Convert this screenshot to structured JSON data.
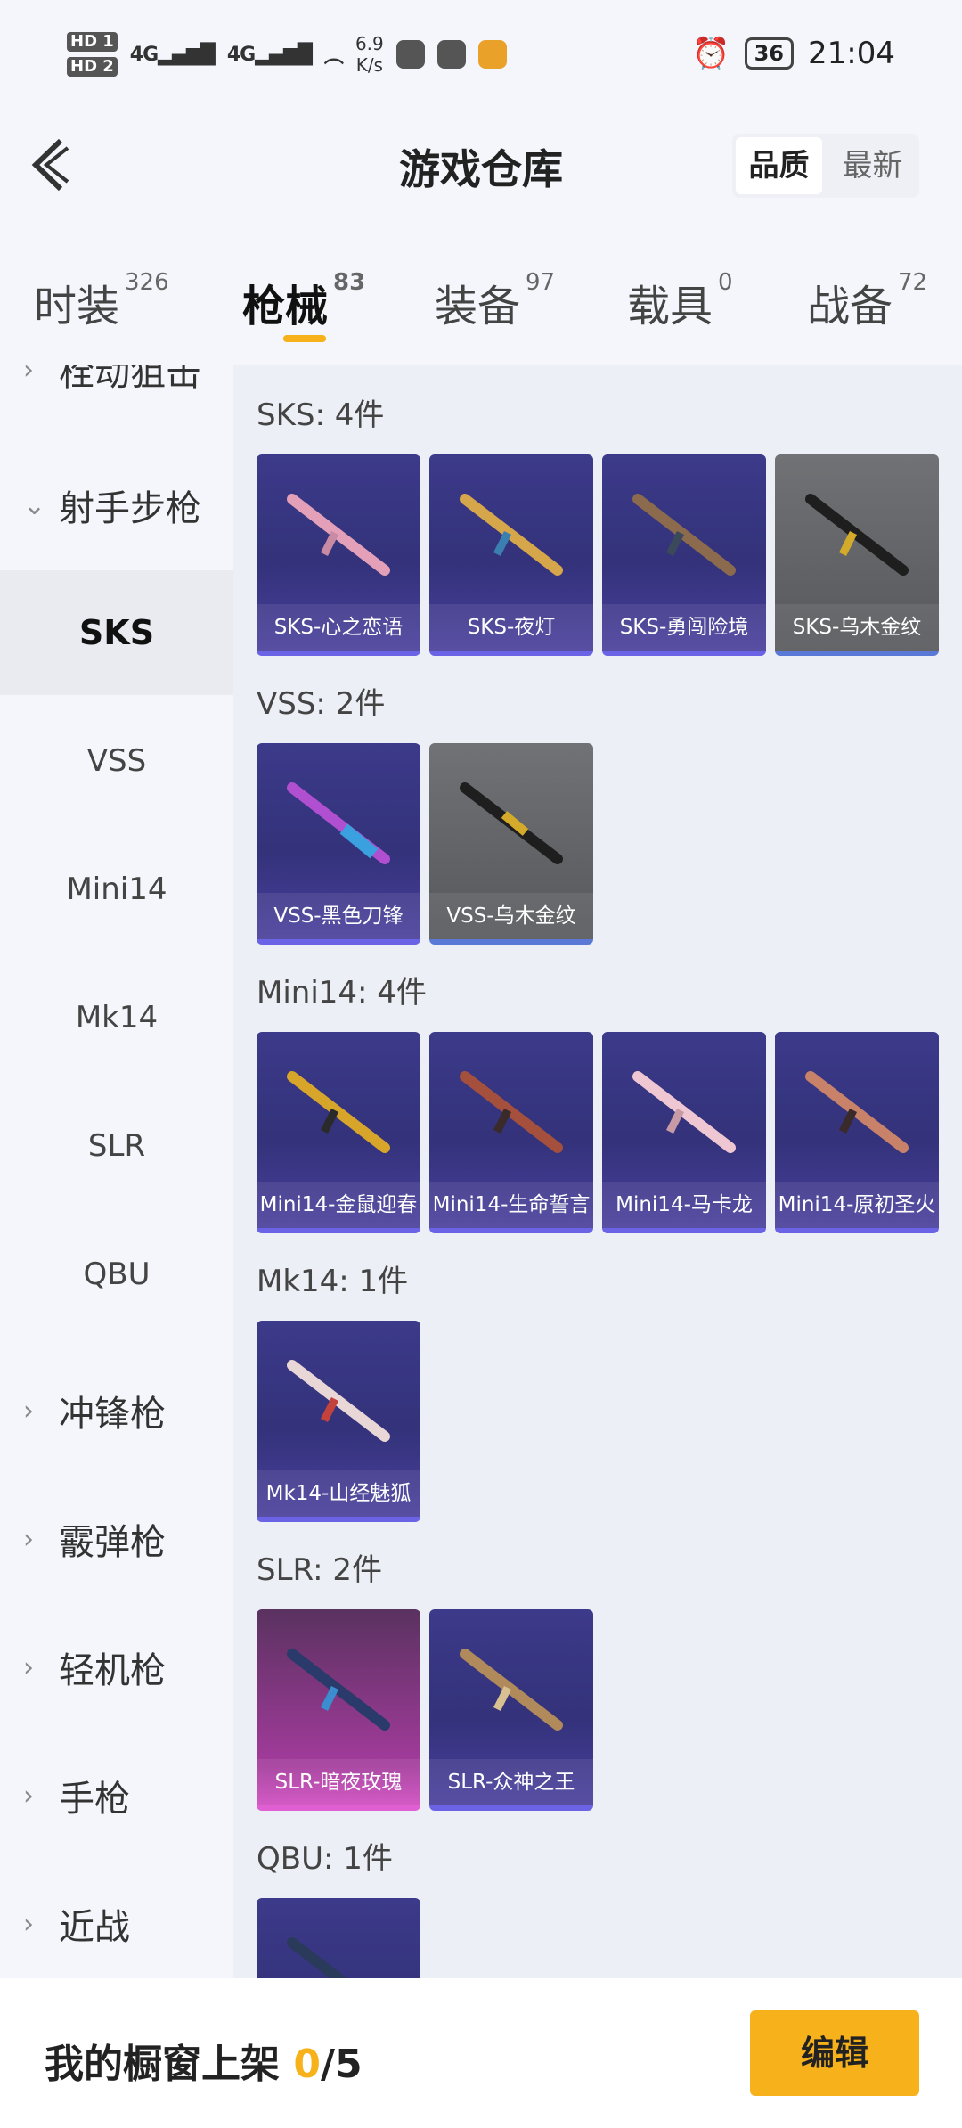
{
  "status_bar": {
    "hd1": "HD 1",
    "hd2": "HD 2",
    "sig1": "4G",
    "sig2": "4G",
    "speed_value": "6.9",
    "speed_unit": "K/s",
    "battery": "36",
    "time": "21:04"
  },
  "header": {
    "title": "游戏仓库",
    "sort_quality": "品质",
    "sort_newest": "最新"
  },
  "tabs": [
    {
      "label": "时装",
      "count": "326"
    },
    {
      "label": "枪械",
      "count": "83"
    },
    {
      "label": "装备",
      "count": "97"
    },
    {
      "label": "载具",
      "count": "0"
    },
    {
      "label": "战备",
      "count": "72"
    }
  ],
  "sidebar": {
    "categories": [
      {
        "label": "栓动狙击"
      },
      {
        "label": "射手步枪"
      },
      {
        "label": "冲锋枪"
      },
      {
        "label": "霰弹枪"
      },
      {
        "label": "轻机枪"
      },
      {
        "label": "手枪"
      },
      {
        "label": "近战"
      }
    ],
    "subs": [
      {
        "label": "SKS"
      },
      {
        "label": "VSS"
      },
      {
        "label": "Mini14"
      },
      {
        "label": "Mk14"
      },
      {
        "label": "SLR"
      },
      {
        "label": "QBU"
      }
    ]
  },
  "groups": [
    {
      "title": "SKS: 4件",
      "items": [
        {
          "name": "SKS-心之恋语",
          "style": "blue"
        },
        {
          "name": "SKS-夜灯",
          "style": "blue"
        },
        {
          "name": "SKS-勇闯险境",
          "style": "blue"
        },
        {
          "name": "SKS-乌木金纹",
          "style": "gray"
        }
      ]
    },
    {
      "title": "VSS: 2件",
      "items": [
        {
          "name": "VSS-黑色刀锋",
          "style": "blue"
        },
        {
          "name": "VSS-乌木金纹",
          "style": "gray"
        }
      ]
    },
    {
      "title": "Mini14: 4件",
      "items": [
        {
          "name": "Mini14-金鼠迎春",
          "style": "blue"
        },
        {
          "name": "Mini14-生命誓言",
          "style": "blue"
        },
        {
          "name": "Mini14-马卡龙",
          "style": "blue"
        },
        {
          "name": "Mini14-原初圣火",
          "style": "blue"
        }
      ]
    },
    {
      "title": "Mk14: 1件",
      "items": [
        {
          "name": "Mk14-山经魅狐",
          "style": "blue"
        }
      ]
    },
    {
      "title": "SLR: 2件",
      "items": [
        {
          "name": "SLR-暗夜玫瑰",
          "style": "pink"
        },
        {
          "name": "SLR-众神之王",
          "style": "blue"
        }
      ]
    },
    {
      "title": "QBU: 1件",
      "items": [
        {
          "name": "",
          "style": "blue"
        }
      ]
    }
  ],
  "bottom": {
    "shelf_label": "我的橱窗上架",
    "shelf_current": "0",
    "shelf_total": "/5",
    "edit": "编辑"
  },
  "colors": {
    "accent": "#f7b21b",
    "item_blue": "#3c3a8a",
    "item_gray": "#606265",
    "item_pink": "#a33b9c"
  }
}
